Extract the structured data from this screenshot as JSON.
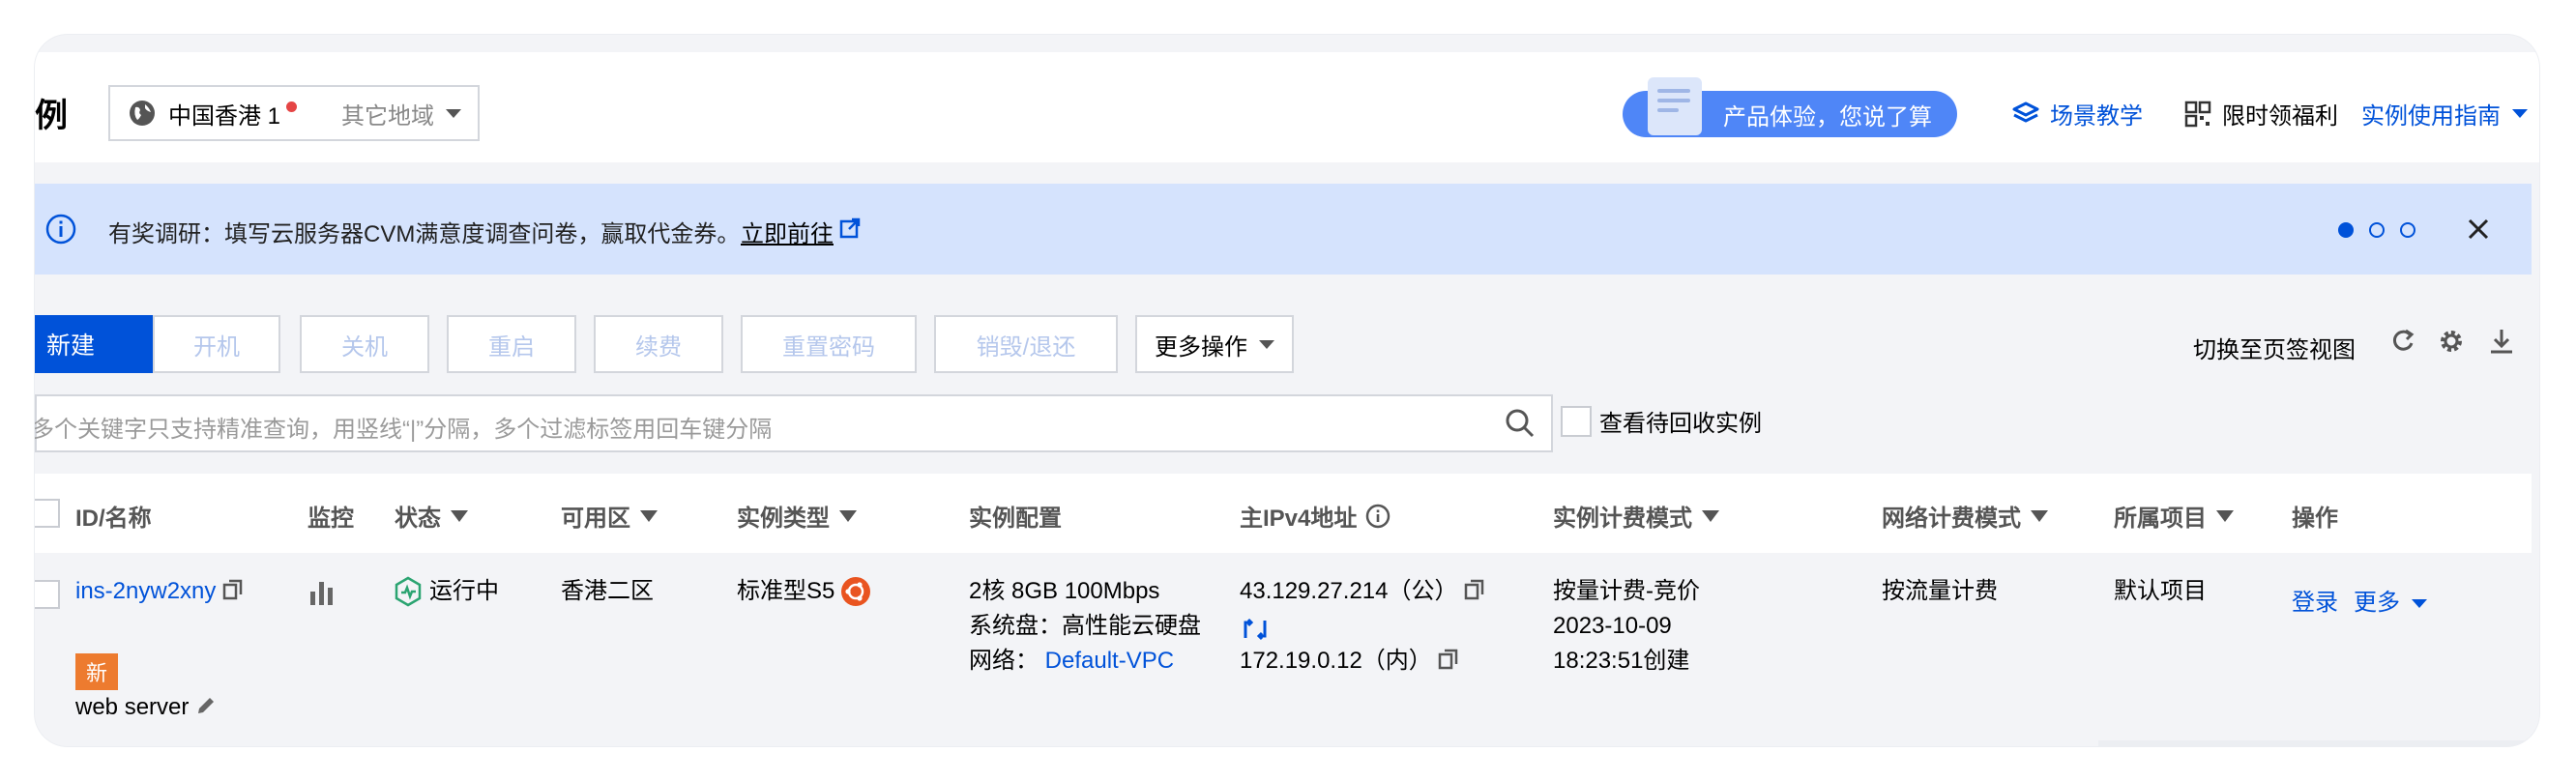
{
  "header": {
    "page_title": "例",
    "region_current": "中国香港 1",
    "region_other": "其它地域",
    "feedback_label": "产品体验，您说了算",
    "links": [
      {
        "label": "场景教学",
        "icon": "layers-icon"
      },
      {
        "label": "限时领福利",
        "icon": "qrcode-icon"
      },
      {
        "label": "实例使用指南",
        "icon": "caret-down-icon"
      }
    ]
  },
  "banner": {
    "text": "有奖调研：填写云服务器CVM满意度调查问卷，赢取代金券。",
    "link": "立即前往",
    "dots_total": 3,
    "dots_active": 1
  },
  "toolbar": {
    "new_label": "新建",
    "start_label": "开机",
    "stop_label": "关机",
    "restart_label": "重启",
    "renew_label": "续费",
    "reset_pwd_label": "重置密码",
    "destroy_label": "销毁/退还",
    "more_label": "更多操作",
    "switch_view_label": "切换至页签视图"
  },
  "search": {
    "placeholder": "多个关键字只支持精准查询，用竖线“|”分隔，多个过滤标签用回车键分隔",
    "recycle_label": "查看待回收实例"
  },
  "table": {
    "headers": {
      "id_name": "ID/名称",
      "monitor": "监控",
      "status": "状态",
      "zone": "可用区",
      "type": "实例类型",
      "config": "实例配置",
      "ipv4": "主IPv4地址",
      "billing": "实例计费模式",
      "net_billing": "网络计费模式",
      "project": "所属项目",
      "ops": "操作"
    },
    "rows": [
      {
        "id": "ins-2nyw2xny",
        "tag": "新",
        "name": "web server",
        "status": "运行中",
        "zone": "香港二区",
        "type": "标准型S5",
        "config_line1": "2核 8GB 100Mbps",
        "config_line2": "系统盘：高性能云硬盘",
        "config_line3_label": "网络：",
        "config_line3_value": "Default-VPC",
        "ip_public": "43.129.27.214（公）",
        "ip_private": "172.19.0.12（内）",
        "billing_line1": "按量计费-竞价",
        "billing_line2": "2023-10-09",
        "billing_line3": "18:23:51创建",
        "net_billing": "按流量计费",
        "project": "默认项目",
        "op_login": "登录",
        "op_more": "更多"
      }
    ]
  },
  "colors": {
    "primary": "#0052d9",
    "banner_bg": "#d5e3fd",
    "tag_orange": "#ed7b2f",
    "running_green": "#2ba471",
    "ubuntu_orange": "#e95420"
  }
}
